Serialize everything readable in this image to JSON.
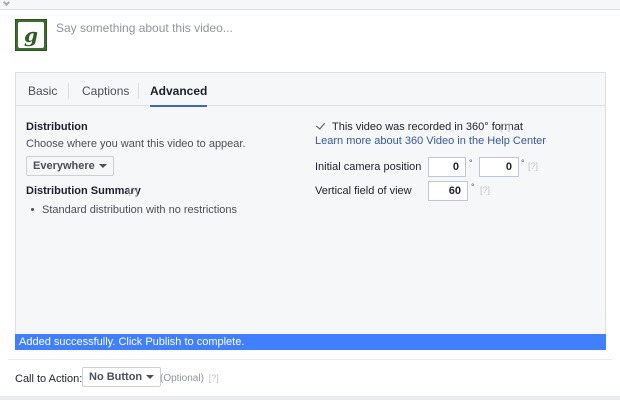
{
  "composer": {
    "avatar_letter": "g",
    "placeholder": "Say something about this video..."
  },
  "tabs": [
    {
      "label": "Basic",
      "active": false
    },
    {
      "label": "Captions",
      "active": false
    },
    {
      "label": "Advanced",
      "active": true
    }
  ],
  "distribution": {
    "heading": "Distribution",
    "description": "Choose where you want this video to appear.",
    "selected": "Everywhere",
    "summary_heading": "Distribution Summary",
    "summary_help": "[?]",
    "summary_items": [
      "Standard distribution with no restrictions"
    ]
  },
  "video360": {
    "checked": true,
    "label": "This video was recorded in 360° format",
    "help": "[?]",
    "learn_more": "Learn more about 360 Video in the Help Center",
    "camera_label": "Initial camera position",
    "camera_x": "0",
    "camera_y": "0",
    "camera_help": "[?]",
    "fov_label": "Vertical field of view",
    "fov_value": "60",
    "fov_help": "[?]",
    "degree_symbol": "°"
  },
  "status": {
    "message": "Added successfully. Click Publish to complete.",
    "color": "#4080ff"
  },
  "cta": {
    "label": "Call to Action:",
    "selected": "No Button",
    "optional": "(Optional)",
    "help": "[?]"
  },
  "colors": {
    "accent": "#4267b2",
    "link": "#365899",
    "panel_bg": "#f6f7f9"
  }
}
